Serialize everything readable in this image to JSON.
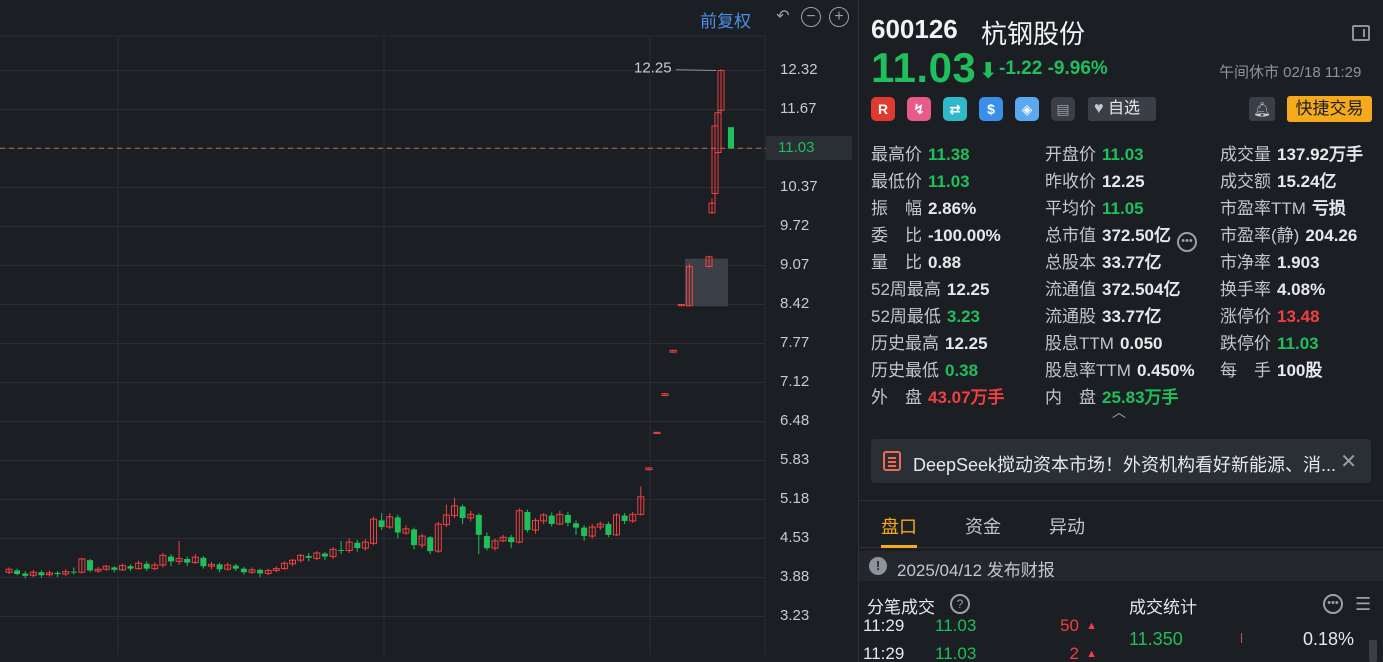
{
  "toolbar": {
    "adjust_label": "前复权",
    "reset_glyph": "↶",
    "zoom_out_glyph": "−",
    "zoom_in_glyph": "+"
  },
  "chart": {
    "y_ticks": [
      "12.32",
      "11.67",
      "11.03",
      "10.37",
      "9.72",
      "9.07",
      "8.42",
      "7.77",
      "7.12",
      "6.48",
      "5.83",
      "5.18",
      "4.53",
      "3.88",
      "3.23"
    ],
    "current_price_tag": "11.03",
    "high_annotation": "12.25",
    "colors": {
      "up": "#f04040",
      "down": "#1fbf5b",
      "box": "#3b4048",
      "grid": "#2a2e34"
    }
  },
  "chart_data": {
    "type": "candlestick",
    "ylim": [
      3.0,
      12.6
    ],
    "current_price": 11.03,
    "annotation": {
      "label": "12.25",
      "value": 12.25
    },
    "candles": [
      [
        4.0,
        4.05,
        3.97,
        4.08
      ],
      [
        4.03,
        3.97,
        3.95,
        4.06
      ],
      [
        3.98,
        3.94,
        3.9,
        4.02
      ],
      [
        3.95,
        4.0,
        3.92,
        4.04
      ],
      [
        4.0,
        3.95,
        3.91,
        4.03
      ],
      [
        3.96,
        3.99,
        3.93,
        4.03
      ],
      [
        3.99,
        3.97,
        3.92,
        4.02
      ],
      [
        3.97,
        4.01,
        3.94,
        4.05
      ],
      [
        4.01,
        4.0,
        3.96,
        4.08
      ],
      [
        4.0,
        4.22,
        3.98,
        4.24
      ],
      [
        4.2,
        4.03,
        4.0,
        4.22
      ],
      [
        4.02,
        4.05,
        3.99,
        4.09
      ],
      [
        4.05,
        4.1,
        4.02,
        4.12
      ],
      [
        4.08,
        4.04,
        4.0,
        4.1
      ],
      [
        4.04,
        4.11,
        4.02,
        4.14
      ],
      [
        4.1,
        4.06,
        4.02,
        4.13
      ],
      [
        4.06,
        4.15,
        4.04,
        4.19
      ],
      [
        4.14,
        4.06,
        4.02,
        4.18
      ],
      [
        4.06,
        4.12,
        4.03,
        4.16
      ],
      [
        4.12,
        4.28,
        4.08,
        4.32
      ],
      [
        4.26,
        4.18,
        4.1,
        4.3
      ],
      [
        4.18,
        4.23,
        4.12,
        4.52
      ],
      [
        4.22,
        4.16,
        4.1,
        4.26
      ],
      [
        4.16,
        4.25,
        4.14,
        4.3
      ],
      [
        4.24,
        4.1,
        4.06,
        4.27
      ],
      [
        4.1,
        4.13,
        4.05,
        4.17
      ],
      [
        4.13,
        4.05,
        4.0,
        4.16
      ],
      [
        4.05,
        4.12,
        4.03,
        4.16
      ],
      [
        4.11,
        4.06,
        4.02,
        4.14
      ],
      [
        4.06,
        4.0,
        3.96,
        4.09
      ],
      [
        4.0,
        4.04,
        3.97,
        4.08
      ],
      [
        4.04,
        3.98,
        3.92,
        4.06
      ],
      [
        3.98,
        4.03,
        3.95,
        4.06
      ],
      [
        4.03,
        4.06,
        4.0,
        4.1
      ],
      [
        4.06,
        4.15,
        4.04,
        4.18
      ],
      [
        4.14,
        4.2,
        4.1,
        4.22
      ],
      [
        4.2,
        4.28,
        4.16,
        4.3
      ],
      [
        4.27,
        4.24,
        4.18,
        4.32
      ],
      [
        4.23,
        4.32,
        4.2,
        4.35
      ],
      [
        4.31,
        4.26,
        4.2,
        4.34
      ],
      [
        4.26,
        4.38,
        4.22,
        4.42
      ],
      [
        4.37,
        4.36,
        4.3,
        4.52
      ],
      [
        4.36,
        4.5,
        4.32,
        4.56
      ],
      [
        4.49,
        4.4,
        4.34,
        4.54
      ],
      [
        4.4,
        4.5,
        4.36,
        4.55
      ],
      [
        4.48,
        4.88,
        4.45,
        4.92
      ],
      [
        4.86,
        4.75,
        4.7,
        4.98
      ],
      [
        4.75,
        4.92,
        4.72,
        4.98
      ],
      [
        4.91,
        4.66,
        4.56,
        4.95
      ],
      [
        4.65,
        4.72,
        4.62,
        4.78
      ],
      [
        4.71,
        4.45,
        4.38,
        4.74
      ],
      [
        4.45,
        4.6,
        4.4,
        4.64
      ],
      [
        4.58,
        4.35,
        4.3,
        4.6
      ],
      [
        4.35,
        4.8,
        4.32,
        4.84
      ],
      [
        4.79,
        4.95,
        4.75,
        5.12
      ],
      [
        4.94,
        5.1,
        4.9,
        5.24
      ],
      [
        5.09,
        4.9,
        4.8,
        5.12
      ],
      [
        4.9,
        4.96,
        4.84,
        5.02
      ],
      [
        4.95,
        4.62,
        4.3,
        4.98
      ],
      [
        4.6,
        4.4,
        4.36,
        4.66
      ],
      [
        4.4,
        4.52,
        4.36,
        4.56
      ],
      [
        4.52,
        4.58,
        4.5,
        4.62
      ],
      [
        4.58,
        4.5,
        4.4,
        4.62
      ],
      [
        4.5,
        5.02,
        4.48,
        5.06
      ],
      [
        5.0,
        4.7,
        4.66,
        5.04
      ],
      [
        4.7,
        4.86,
        4.64,
        4.9
      ],
      [
        4.85,
        4.95,
        4.8,
        4.98
      ],
      [
        4.94,
        4.8,
        4.76,
        4.99
      ],
      [
        4.8,
        4.96,
        4.78,
        5.02
      ],
      [
        4.95,
        4.82,
        4.76,
        5.0
      ],
      [
        4.81,
        4.74,
        4.62,
        4.86
      ],
      [
        4.74,
        4.6,
        4.52,
        4.78
      ],
      [
        4.6,
        4.75,
        4.56,
        4.8
      ],
      [
        4.75,
        4.8,
        4.7,
        4.84
      ],
      [
        4.8,
        4.62,
        4.58,
        4.84
      ],
      [
        4.62,
        4.95,
        4.6,
        4.98
      ],
      [
        4.94,
        4.85,
        4.8,
        4.98
      ],
      [
        4.85,
        4.96,
        4.82,
        5.0
      ],
      [
        4.96,
        5.25,
        4.94,
        5.42
      ],
      [
        5.7,
        5.73,
        5.69,
        5.74
      ],
      [
        6.3,
        6.32,
        6.29,
        6.33
      ],
      [
        6.93,
        6.96,
        6.92,
        6.97
      ],
      [
        7.65,
        7.68,
        7.64,
        7.69
      ],
      [
        8.42,
        8.44,
        8.41,
        8.45
      ],
      [
        8.42,
        9.07,
        8.41,
        9.12
      ],
      [
        9.07,
        9.23,
        9.05,
        9.25
      ],
      [
        9.96,
        10.12,
        9.94,
        10.2
      ],
      [
        10.28,
        11.4,
        10.0,
        11.42
      ],
      [
        10.96,
        11.62,
        10.6,
        11.68
      ],
      [
        11.66,
        12.32,
        11.52,
        12.34
      ],
      [
        11.38,
        11.03,
        11.03,
        11.38
      ]
    ]
  },
  "stock": {
    "code": "600126",
    "name": "杭钢股份",
    "price": "11.03",
    "arrow": "⬇",
    "change": "-1.22",
    "change_pct": "-9.96%",
    "status": "午间休市 02/18 11:29"
  },
  "tags": [
    "R",
    "↯",
    "⇄",
    "$",
    "◈",
    "▤"
  ],
  "watchlist_label": "自选",
  "quick_trade_label": "快捷交易",
  "stats": [
    {
      "k": "最高价",
      "v": "11.38",
      "c": "g"
    },
    {
      "k": "开盘价",
      "v": "11.03",
      "c": "g"
    },
    {
      "k": "成交量",
      "v": "137.92万手",
      "c": ""
    },
    {
      "k": "最低价",
      "v": "11.03",
      "c": "g"
    },
    {
      "k": "昨收价",
      "v": "12.25",
      "c": ""
    },
    {
      "k": "成交额",
      "v": "15.24亿",
      "c": ""
    },
    {
      "k": "振　幅",
      "v": "2.86%",
      "c": ""
    },
    {
      "k": "平均价",
      "v": "11.05",
      "c": "g"
    },
    {
      "k": "市盈率TTM",
      "v": "亏损",
      "c": ""
    },
    {
      "k": "委　比",
      "v": "-100.00%",
      "c": ""
    },
    {
      "k": "总市值",
      "v": "372.50亿",
      "c": ""
    },
    {
      "k": "市盈率(静)",
      "v": "204.26",
      "c": ""
    },
    {
      "k": "量　比",
      "v": "0.88",
      "c": ""
    },
    {
      "k": "总股本",
      "v": "33.77亿",
      "c": ""
    },
    {
      "k": "市净率",
      "v": "1.903",
      "c": ""
    },
    {
      "k": "52周最高",
      "v": "12.25",
      "c": ""
    },
    {
      "k": "流通值",
      "v": "372.504亿",
      "c": ""
    },
    {
      "k": "换手率",
      "v": "4.08%",
      "c": ""
    },
    {
      "k": "52周最低",
      "v": "3.23",
      "c": "g"
    },
    {
      "k": "流通股",
      "v": "33.77亿",
      "c": ""
    },
    {
      "k": "涨停价",
      "v": "13.48",
      "c": "r"
    },
    {
      "k": "历史最高",
      "v": "12.25",
      "c": ""
    },
    {
      "k": "股息TTM",
      "v": "0.050",
      "c": ""
    },
    {
      "k": "跌停价",
      "v": "11.03",
      "c": "g"
    },
    {
      "k": "历史最低",
      "v": "0.38",
      "c": "g"
    },
    {
      "k": "股息率TTM",
      "v": "0.450%",
      "c": ""
    },
    {
      "k": "每　手",
      "v": "100股",
      "c": ""
    },
    {
      "k": "外　盘",
      "v": "43.07万手",
      "c": "r"
    },
    {
      "k": "内　盘",
      "v": "25.83万手",
      "c": "g"
    }
  ],
  "news": {
    "text": "DeepSeek搅动资本市场！外资机构看好新能源、消...",
    "close": "✕"
  },
  "tabs": [
    "盘口",
    "资金",
    "异动"
  ],
  "report": {
    "icon": "!",
    "text": "2025/04/12  发布财报"
  },
  "trades_title": "分笔成交",
  "summary_title": "成交统计",
  "trades": [
    {
      "time": "11:29",
      "price": "11.03",
      "vol": "50"
    },
    {
      "time": "11:29",
      "price": "11.03",
      "vol": "2"
    }
  ],
  "summary": {
    "price": "11.350",
    "pct": "0.18%"
  }
}
